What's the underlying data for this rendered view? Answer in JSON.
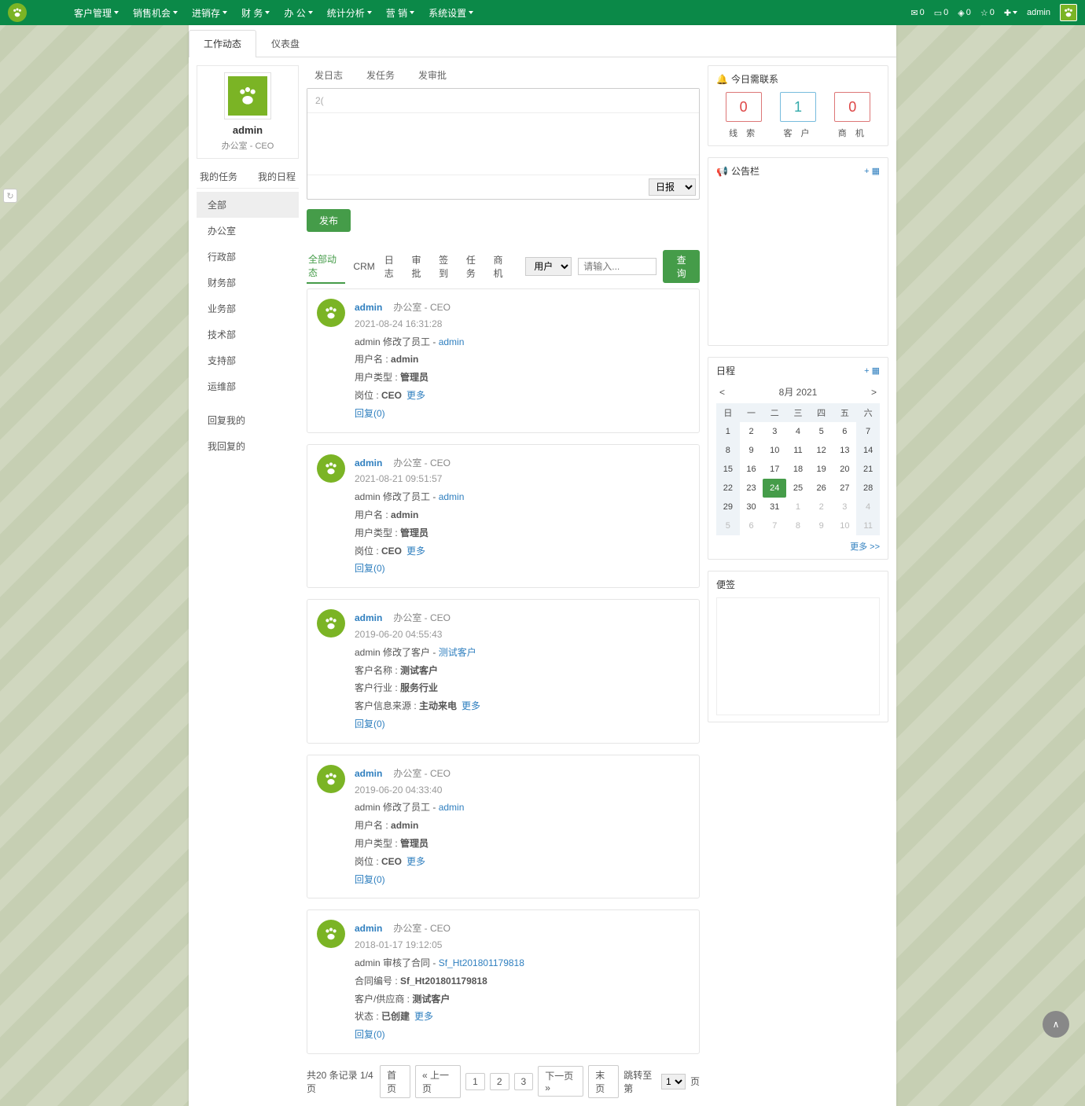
{
  "nav": {
    "menus": [
      "客户管理",
      "销售机会",
      "进销存",
      "财 务",
      "办 公",
      "统计分析",
      "营 销",
      "系统设置"
    ],
    "mail": "0",
    "msg": "0",
    "diamond": "0",
    "star": "0",
    "user": "admin"
  },
  "tabs": {
    "work": "工作动态",
    "dash": "仪表盘"
  },
  "profile": {
    "name": "admin",
    "role": "办公室 - CEO",
    "mytask": "我的任务",
    "mycal": "我的日程"
  },
  "deps": [
    "全部",
    "办公室",
    "行政部",
    "财务部",
    "业务部",
    "技术部",
    "支持部",
    "运维部"
  ],
  "deps2": [
    "回复我的",
    "我回复的"
  ],
  "post": {
    "tabs": [
      "发日志",
      "发任务",
      "发审批"
    ],
    "title_ph": "2(",
    "select": "日报",
    "publish": "发布"
  },
  "filters": {
    "items": [
      "全部动态",
      "CRM",
      "日志",
      "审批",
      "签到",
      "任务",
      "商机"
    ],
    "sel": "用户",
    "ph": "请输入...",
    "btn": "查询"
  },
  "feed": [
    {
      "author": "admin",
      "role": "办公室 - CEO",
      "time": "2021-08-24 16:31:28",
      "action": "admin 修改了员工 - ",
      "target": "admin",
      "lines": [
        [
          "用户名 : ",
          "admin"
        ],
        [
          "用户类型 : ",
          "管理员"
        ],
        [
          "岗位 : ",
          "CEO"
        ]
      ],
      "more": "更多",
      "reply": "回复(0)"
    },
    {
      "author": "admin",
      "role": "办公室 - CEO",
      "time": "2021-08-21 09:51:57",
      "action": "admin 修改了员工 - ",
      "target": "admin",
      "lines": [
        [
          "用户名 : ",
          "admin"
        ],
        [
          "用户类型 : ",
          "管理员"
        ],
        [
          "岗位 : ",
          "CEO"
        ]
      ],
      "more": "更多",
      "reply": "回复(0)"
    },
    {
      "author": "admin",
      "role": "办公室 - CEO",
      "time": "2019-06-20 04:55:43",
      "action": "admin 修改了客户 - ",
      "target": "测试客户",
      "lines": [
        [
          "客户名称 : ",
          "测试客户"
        ],
        [
          "客户行业 : ",
          "服务行业"
        ],
        [
          "客户信息来源 : ",
          "主动来电"
        ]
      ],
      "more": "更多",
      "reply": "回复(0)"
    },
    {
      "author": "admin",
      "role": "办公室 - CEO",
      "time": "2019-06-20 04:33:40",
      "action": "admin 修改了员工 - ",
      "target": "admin",
      "lines": [
        [
          "用户名 : ",
          "admin"
        ],
        [
          "用户类型 : ",
          "管理员"
        ],
        [
          "岗位 : ",
          "CEO"
        ]
      ],
      "more": "更多",
      "reply": "回复(0)"
    },
    {
      "author": "admin",
      "role": "办公室 - CEO",
      "time": "2018-01-17 19:12:05",
      "action": "admin 审核了合同 - ",
      "target": "Sf_Ht201801179818",
      "lines": [
        [
          "合同编号 : ",
          "Sf_Ht201801179818"
        ],
        [
          "客户/供应商 : ",
          "测试客户"
        ],
        [
          "状态 : ",
          "已创建"
        ]
      ],
      "more": "更多",
      "reply": "回复(0)"
    }
  ],
  "pager": {
    "info": "共20 条记录 1/4 页",
    "first": "首页",
    "prev": "« 上一页",
    "p1": "1",
    "p2": "2",
    "p3": "3",
    "next": "下一页 »",
    "last": "末页",
    "jump": "跳转至第",
    "jumppg": "1",
    "pgend": "页"
  },
  "right": {
    "contact": {
      "title": "今日需联系",
      "c": [
        [
          "0",
          "线 索"
        ],
        [
          "1",
          "客 户"
        ],
        [
          "0",
          "商 机"
        ]
      ]
    },
    "board": {
      "title": "公告栏",
      "add": "+ ▦"
    },
    "cal": {
      "title": "日程",
      "add": "+ ▦",
      "month": "8月 2021",
      "head": [
        "日",
        "一",
        "二",
        "三",
        "四",
        "五",
        "六"
      ],
      "weeks": [
        [
          "1",
          "2",
          "3",
          "4",
          "5",
          "6",
          "7"
        ],
        [
          "8",
          "9",
          "10",
          "11",
          "12",
          "13",
          "14"
        ],
        [
          "15",
          "16",
          "17",
          "18",
          "19",
          "20",
          "21"
        ],
        [
          "22",
          "23",
          "24",
          "25",
          "26",
          "27",
          "28"
        ],
        [
          "29",
          "30",
          "31",
          "1",
          "2",
          "3",
          "4"
        ],
        [
          "5",
          "6",
          "7",
          "8",
          "9",
          "10",
          "11"
        ]
      ],
      "today": "24",
      "more": "更多 >>"
    },
    "sticky": {
      "title": "便签"
    }
  }
}
